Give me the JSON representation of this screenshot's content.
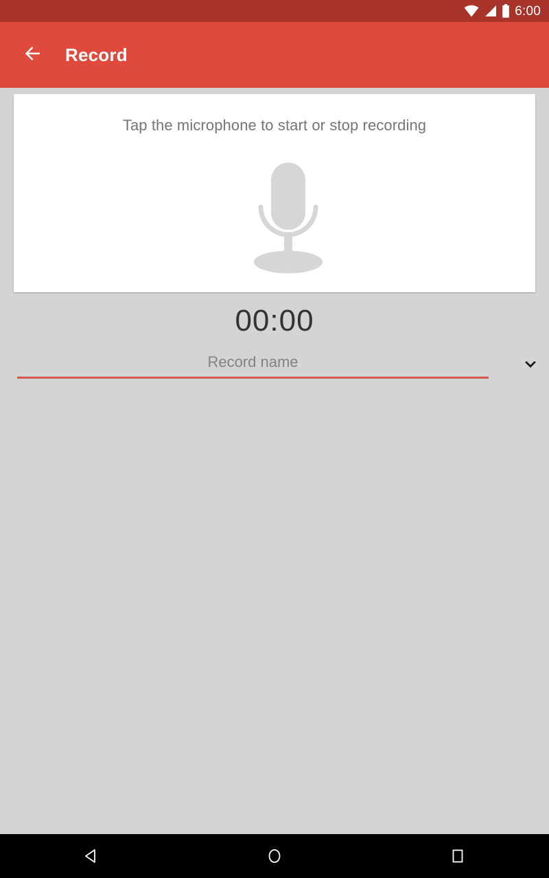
{
  "status_bar": {
    "time": "6:00",
    "icons": [
      "wifi-icon",
      "cellular-signal-icon",
      "battery-icon"
    ],
    "background_color": "#a8332a"
  },
  "app_bar": {
    "title": "Record",
    "back_icon": "arrow-left-icon",
    "background_color": "#df4a3c",
    "text_color": "#ffffff"
  },
  "card": {
    "hint_text": "Tap the microphone to start or stop recording",
    "mic_icon": "microphone-icon",
    "mic_color": "#d6d6d6",
    "background_color": "#ffffff"
  },
  "timer": {
    "value": "00:00",
    "text_color": "#333333"
  },
  "record_name": {
    "placeholder": "Record name",
    "value": "",
    "underline_color": "#d4584a",
    "dropdown_icon": "chevron-down-icon"
  },
  "nav_bar": {
    "back_icon": "nav-back-triangle-icon",
    "home_icon": "nav-home-circle-icon",
    "recents_icon": "nav-recents-square-icon",
    "background_color": "#000000"
  },
  "page": {
    "background_color": "#d4d4d4"
  }
}
